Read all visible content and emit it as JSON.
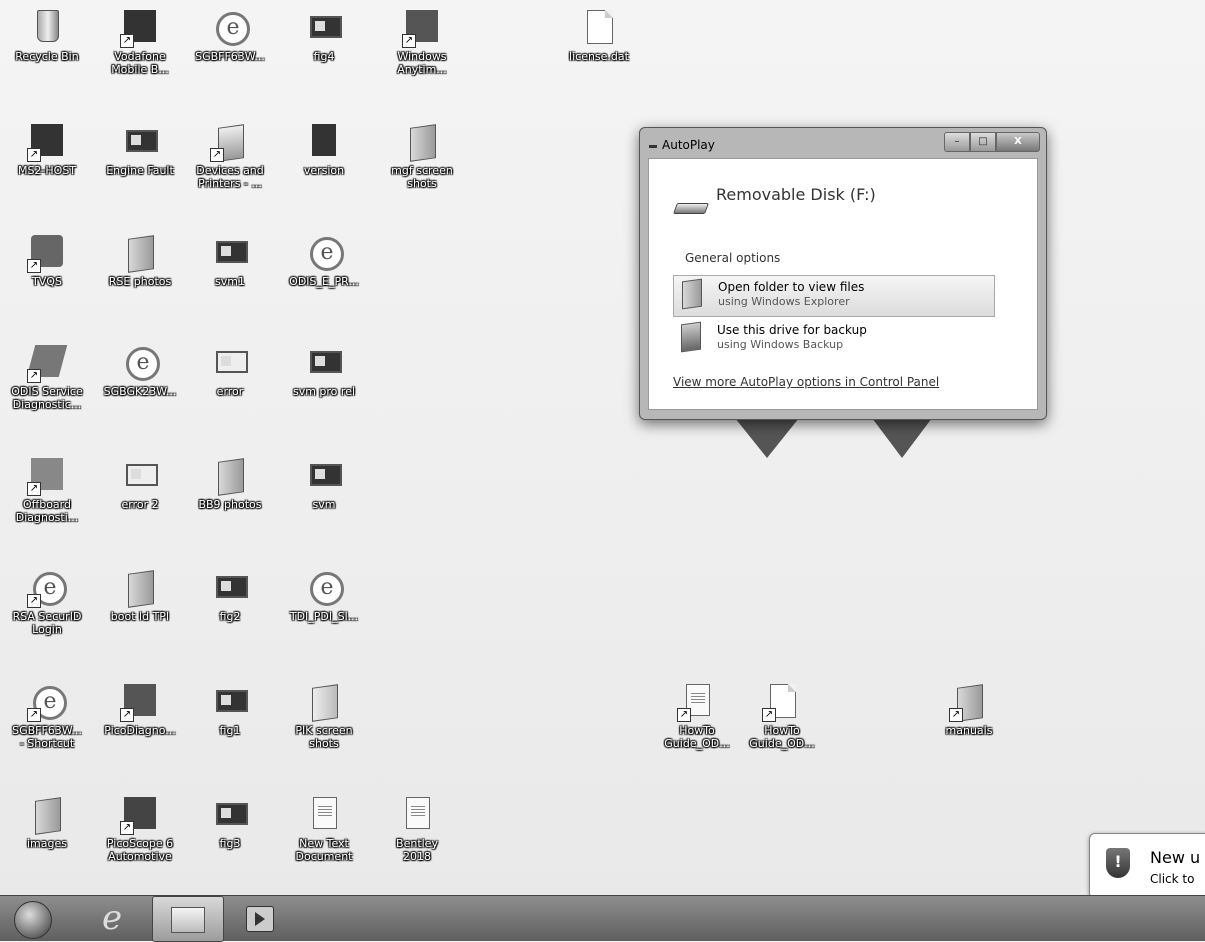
{
  "desktop": {
    "icons": [
      {
        "label": "Recycle Bin"
      },
      {
        "label": "Vodafone\nMobile B..."
      },
      {
        "label": "SGBFF63W..."
      },
      {
        "label": "fig4"
      },
      {
        "label": "Windows\nAnytim..."
      },
      {
        "label": "license.dat"
      },
      {
        "label": "MS2-HOST"
      },
      {
        "label": "Engine Fault"
      },
      {
        "label": "Devices and\nPrinters - ..."
      },
      {
        "label": "version"
      },
      {
        "label": "mgf screen\nshots"
      },
      {
        "label": "TVQS"
      },
      {
        "label": "RSE photos"
      },
      {
        "label": "svm1"
      },
      {
        "label": "ODIS_E_PR..."
      },
      {
        "label": "ODIS Service\nDiagnostic..."
      },
      {
        "label": "SGBGK23W..."
      },
      {
        "label": "error"
      },
      {
        "label": "svm pro rel"
      },
      {
        "label": "Offboard\nDiagnosti..."
      },
      {
        "label": "error 2"
      },
      {
        "label": "BB9 photos"
      },
      {
        "label": "svm"
      },
      {
        "label": "RSA SecurID\nLogin"
      },
      {
        "label": "boot ld TPI"
      },
      {
        "label": "fig2"
      },
      {
        "label": "TDI_PDI_Sl..."
      },
      {
        "label": "SGBFF63W...\n- Shortcut"
      },
      {
        "label": "PicoDiagno..."
      },
      {
        "label": "fig1"
      },
      {
        "label": "PIK screen\nshots"
      },
      {
        "label": "images"
      },
      {
        "label": "PicoScope 6\nAutomotive"
      },
      {
        "label": "fig3"
      },
      {
        "label": "New Text\nDocument"
      },
      {
        "label": "Bentley\n2018"
      },
      {
        "label": "HowTo\nGuide_OD..."
      },
      {
        "label": "HowTo\nGuide_OD..."
      },
      {
        "label": "manuals"
      }
    ]
  },
  "autoplay": {
    "title": "AutoPlay",
    "device": "Removable Disk (F:)",
    "section": "General options",
    "option1_title": "Open folder to view files",
    "option1_sub": "using Windows Explorer",
    "option2_title": "Use this drive for backup",
    "option2_sub": "using Windows Backup",
    "more_link": "View more AutoPlay options in Control Panel",
    "close_glyph": "X"
  },
  "notification": {
    "title": "New u",
    "subtitle": "Click to"
  },
  "taskbar": {
    "ie_glyph": "e"
  },
  "icons": {
    "shortcut_arrow": "↗",
    "shield_glyph": "!",
    "ie_glyph": "e"
  }
}
